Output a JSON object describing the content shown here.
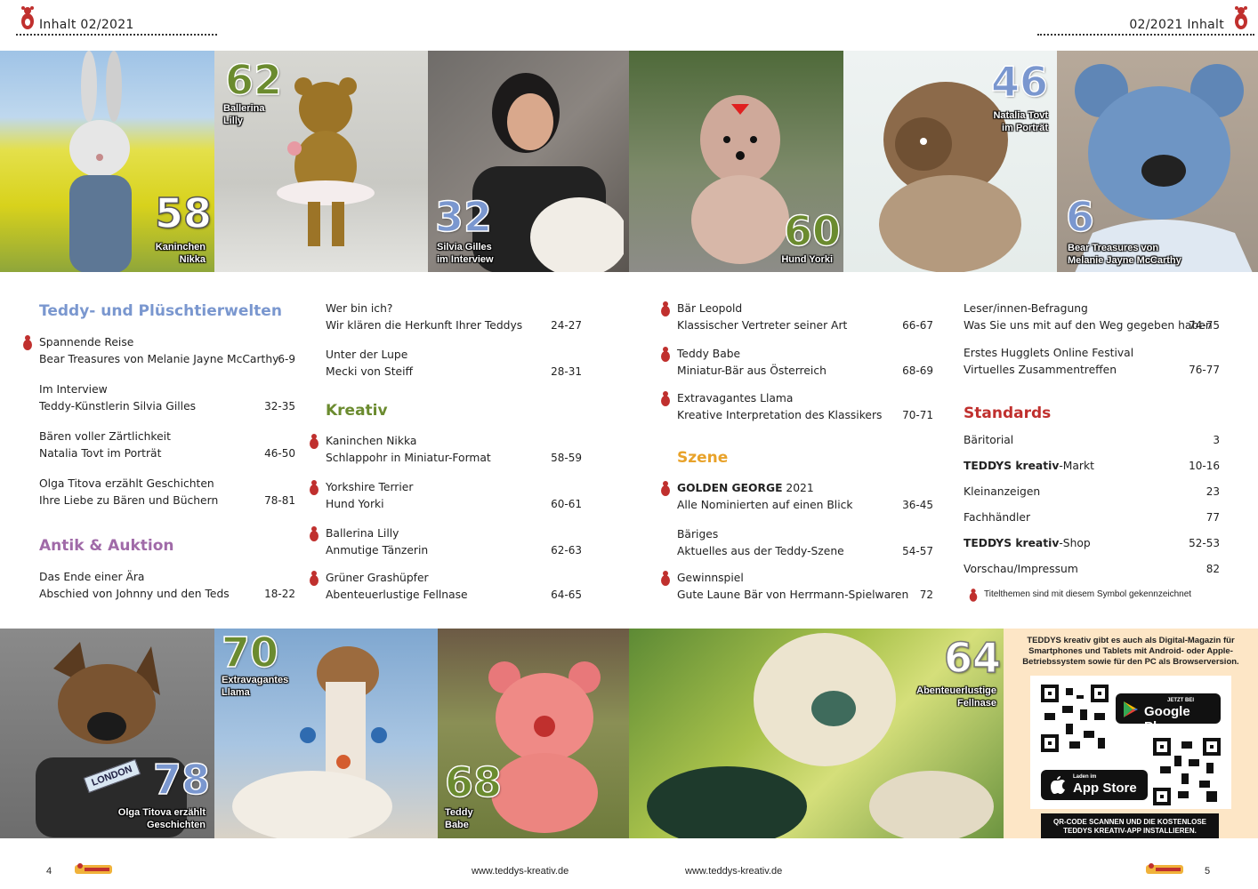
{
  "header": {
    "left_label": "Inhalt 02/2021",
    "right_label": "02/2021 Inhalt"
  },
  "top_photos": [
    {
      "number": "58",
      "caption_lines": [
        "Kaninchen",
        "Nikka"
      ]
    },
    {
      "number": "62",
      "caption_lines": [
        "Ballerina",
        "Lilly"
      ]
    },
    {
      "number": "32",
      "caption_lines": [
        "Silvia Gilles",
        "im Interview"
      ]
    },
    {
      "number": "60",
      "caption_lines": [
        "Hund Yorki"
      ]
    },
    {
      "number": "46",
      "caption_lines": [
        "Natalia Tovt",
        "im Porträt"
      ]
    },
    {
      "number": "6",
      "caption_lines": [
        "Bear Treasures von",
        "Melanie Jayne McCarthy"
      ]
    }
  ],
  "bottom_photos": [
    {
      "number": "78",
      "caption_lines": [
        "Olga Titova erzählt",
        "Geschichten"
      ],
      "badge": "LONDON"
    },
    {
      "number": "70",
      "caption_lines": [
        "Extravagantes",
        "Llama"
      ]
    },
    {
      "number": "68",
      "caption_lines": [
        "Teddy",
        "Babe"
      ]
    },
    {
      "number": "64",
      "caption_lines": [
        "Abenteuerlustige",
        "Fellnase"
      ]
    }
  ],
  "sections": {
    "teddy": {
      "title": "Teddy- und Plüschtierwelten",
      "entries": [
        {
          "line1": "Spannende Reise",
          "line2": "Bear Treasures von Melanie Jayne McCarthy",
          "pages": "6-9",
          "cover": true
        },
        {
          "line1": "Im Interview",
          "line2": "Teddy-Künstlerin Silvia Gilles",
          "pages": "32-35",
          "cover": false
        },
        {
          "line1": "Bären voller Zärtlichkeit",
          "line2": "Natalia Tovt im Porträt",
          "pages": "46-50",
          "cover": false
        },
        {
          "line1": "Olga Titova erzählt Geschichten",
          "line2": "Ihre Liebe zu Bären und Büchern",
          "pages": "78-81",
          "cover": false
        }
      ]
    },
    "antik": {
      "title": "Antik & Auktion",
      "entries": [
        {
          "line1": "Das Ende einer Ära",
          "line2": "Abschied von Johnny und den Teds",
          "pages": "18-22",
          "cover": false
        }
      ]
    },
    "col2_top": {
      "entries": [
        {
          "line1": "Wer bin ich?",
          "line2": "Wir klären die Herkunft Ihrer Teddys",
          "pages": "24-27",
          "cover": false
        },
        {
          "line1": "Unter der Lupe",
          "line2": "Mecki von Steiff",
          "pages": "28-31",
          "cover": false
        }
      ]
    },
    "kreativ": {
      "title": "Kreativ",
      "entries": [
        {
          "line1": "Kaninchen Nikka",
          "line2": "Schlappohr in Miniatur-Format",
          "pages": "58-59",
          "cover": true
        },
        {
          "line1": "Yorkshire Terrier",
          "line2": "Hund Yorki",
          "pages": "60-61",
          "cover": true
        },
        {
          "line1": "Ballerina Lilly",
          "line2": "Anmutige Tänzerin",
          "pages": "62-63",
          "cover": true
        },
        {
          "line1": "Grüner Grashüpfer",
          "line2": "Abenteuerlustige Fellnase",
          "pages": "64-65",
          "cover": true
        }
      ]
    },
    "col3_top": {
      "entries": [
        {
          "line1": "Bär Leopold",
          "line2": "Klassischer Vertreter seiner Art",
          "pages": "66-67",
          "cover": true
        },
        {
          "line1": "Teddy Babe",
          "line2": "Miniatur-Bär aus Österreich",
          "pages": "68-69",
          "cover": true
        },
        {
          "line1": "Extravagantes Llama",
          "line2": "Kreative Interpretation des Klassikers",
          "pages": "70-71",
          "cover": true
        }
      ]
    },
    "szene": {
      "title": "Szene",
      "entries": [
        {
          "line1_bold": "GOLDEN GEORGE",
          "line1_rest": " 2021",
          "line2": "Alle Nominierten auf einen Blick",
          "pages": "36-45",
          "cover": true
        },
        {
          "line1": "Bäriges",
          "line2": "Aktuelles aus der Teddy-Szene",
          "pages": "54-57",
          "cover": false
        },
        {
          "line1": "Gewinnspiel",
          "line2": "Gute Laune Bär von Herrmann-Spielwaren",
          "pages": "72",
          "cover": true
        }
      ]
    },
    "col4_top": {
      "entries": [
        {
          "line1": "Leser/innen-Befragung",
          "line2": "Was Sie uns mit auf den Weg gegeben haben",
          "pages": "74-75"
        },
        {
          "line1": "Erstes Hugglets Online Festival",
          "line2": "Virtuelles Zusammentreffen",
          "pages": "76-77"
        }
      ]
    },
    "standards": {
      "title": "Standards",
      "items": [
        {
          "label": "Bäritorial",
          "pages": "3"
        },
        {
          "label_bold": "TEDDYS kreativ",
          "label_rest": "-Markt",
          "pages": "10-16"
        },
        {
          "label": "Kleinanzeigen",
          "pages": "23"
        },
        {
          "label": "Fachhändler",
          "pages": "77"
        },
        {
          "label_bold": "TEDDYS kreativ",
          "label_rest": "-Shop",
          "pages": "52-53"
        },
        {
          "label": "Vorschau/Impressum",
          "pages": "82"
        }
      ],
      "legend": "Titelthemen sind mit diesem Symbol gekennzeichnet"
    }
  },
  "promo": {
    "text": "TEDDYS kreativ gibt es auch als Digital-Magazin für Smartphones und Tablets mit Android- oder Apple-Betriebssystem sowie für den PC als Browserversion.",
    "google_small": "JETZT BEI",
    "google_big": "Google Play",
    "apple_small": "Laden im",
    "apple_big": "App Store",
    "cta": "QR-CODE SCANNEN UND DIE KOSTENLOSE TEDDYS KREATIV-APP INSTALLIEREN."
  },
  "footer": {
    "page_left": "4",
    "page_right": "5",
    "url_left": "www.teddys-kreativ.de",
    "url_right": "www.teddys-kreativ.de"
  },
  "colors": {
    "teddy_blue": "#7a97cf",
    "antik_purple": "#a06aa8",
    "kreativ_green": "#6b8b2f",
    "szene_orange": "#e8a22a",
    "standards_red": "#c0302e",
    "promo_bg": "#fde6c6"
  }
}
